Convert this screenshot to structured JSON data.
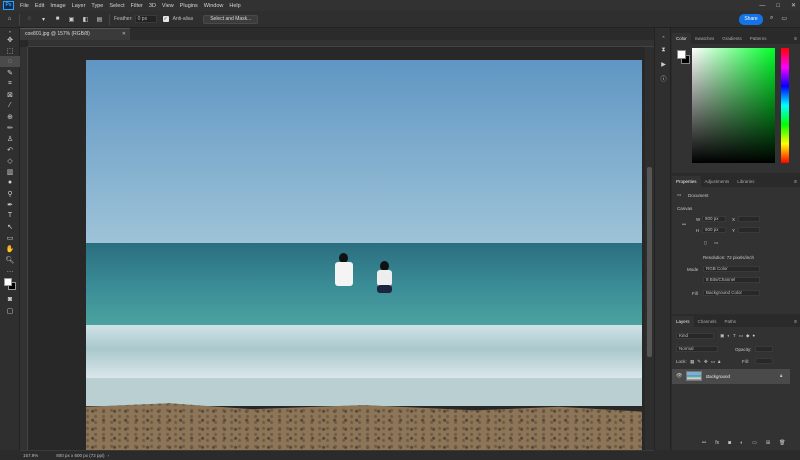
{
  "menu": [
    "File",
    "Edit",
    "Image",
    "Layer",
    "Type",
    "Select",
    "Filter",
    "3D",
    "View",
    "Plugins",
    "Window",
    "Help"
  ],
  "app_logo": "Ps",
  "options_bar": {
    "feather_label": "Feather:",
    "feather_value": "0 px",
    "antialias_label": "Anti-alias",
    "select_mask_button": "Select and Mask..."
  },
  "share_button": "Share",
  "document": {
    "tab_title": "coe801.jpg @ 157% (RGB/8)",
    "zoom": "157.9%",
    "status_info": "800 px x 600 px (72 ppi)"
  },
  "color_panel": {
    "tabs": [
      "Color",
      "Swatches",
      "Gradients",
      "Patterns"
    ],
    "foreground": "#ffffff",
    "background": "#000000"
  },
  "properties_panel": {
    "tabs": [
      "Properties",
      "Adjustments",
      "Libraries"
    ],
    "doc_label": "Document",
    "canvas_section": "Canvas",
    "w_label": "W",
    "w_value": "800 px",
    "h_label": "H",
    "h_value": "600 px",
    "x_label": "X",
    "y_label": "Y",
    "resolution": "Resolution: 72 pixels/inch",
    "mode_label": "Mode",
    "mode_value": "RGB Color",
    "depth_value": "8 Bits/Channel",
    "fill_label": "Fill",
    "fill_value": "Background Color"
  },
  "layers_panel": {
    "tabs": [
      "Layers",
      "Channels",
      "Paths"
    ],
    "search_placeholder": "Kind",
    "blend_mode": "Normal",
    "opacity_label": "Opacity:",
    "lock_label": "Lock:",
    "fill_label": "Fill:",
    "layers": [
      {
        "name": "Background",
        "visible": true,
        "locked": true
      }
    ]
  }
}
